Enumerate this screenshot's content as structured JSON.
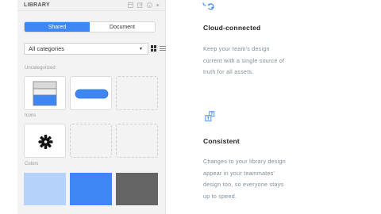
{
  "library": {
    "title": "LIBRARY",
    "header_icons": [
      "library-icon",
      "edit-icon",
      "info-icon",
      "play-icon"
    ],
    "tabs": [
      {
        "label": "Shared",
        "active": true
      },
      {
        "label": "Document",
        "active": false
      }
    ],
    "category_select": {
      "value": "All categories"
    },
    "sections": {
      "uncategorized": "Uncategorized",
      "icons": "Icons",
      "colors": "Colors"
    },
    "colors": [
      "#b5d2fb",
      "#3d86f4",
      "#646464"
    ],
    "accent": "#3d86f4"
  },
  "features": [
    {
      "icon": "cloud-sync-icon",
      "title": "Cloud-connected",
      "lines": [
        "Keep your team's design",
        "current with a single source of",
        "truth for all assets."
      ]
    },
    {
      "icon": "symbol-transfer-icon",
      "title": "Consistent",
      "lines": [
        "Changes to your library design",
        "appear in your teammates'",
        "design too, so everyone stays",
        "up to speed."
      ]
    }
  ]
}
